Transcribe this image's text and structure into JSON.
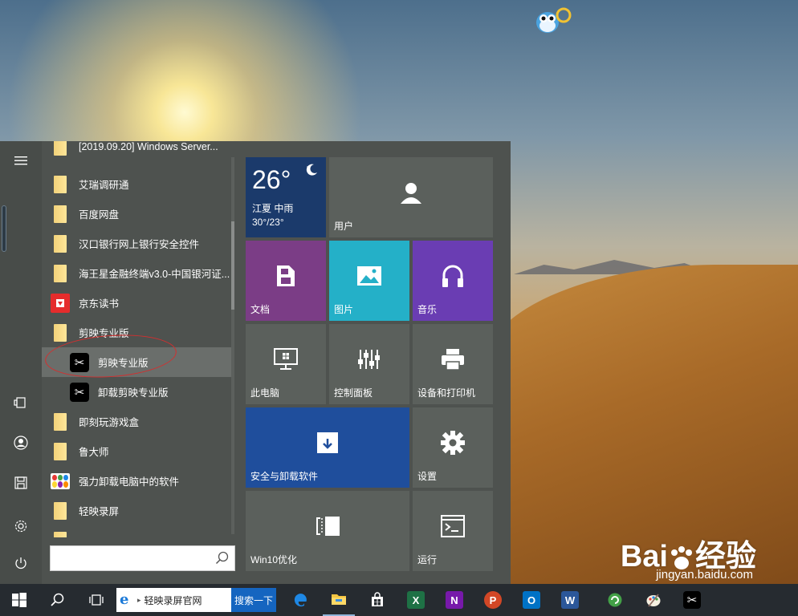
{
  "colors": {
    "start_bg": "#4e524f",
    "tile_weather": "#1b3a6b",
    "tile_gray": "#5b605c",
    "tile_docs": "#7b3d86",
    "tile_pictures": "#24b0c8",
    "tile_music": "#6a3db3",
    "tile_install": "#1f4e9c",
    "annotation": "#d32f2f",
    "taskbar": "#262b30"
  },
  "start_menu": {
    "rail": [
      "hamburger-icon",
      "tablet-icon",
      "user-icon",
      "documents-icon",
      "settings-icon",
      "power-icon"
    ],
    "app_list": [
      {
        "label": "[2019.09.20] Windows Server...",
        "icon": "folder-icon",
        "type": "folder"
      },
      {
        "label": "艾瑞调研通",
        "icon": "folder-icon",
        "type": "folder"
      },
      {
        "label": "百度网盘",
        "icon": "folder-icon",
        "type": "folder"
      },
      {
        "label": "汉口银行网上银行安全控件",
        "icon": "folder-icon",
        "type": "folder"
      },
      {
        "label": "海王星金融终端v3.0-中国银河证...",
        "icon": "folder-icon",
        "type": "folder"
      },
      {
        "label": "京东读书",
        "icon": "jd-read-icon",
        "type": "app"
      },
      {
        "label": "剪映专业版",
        "icon": "folder-icon",
        "type": "folder"
      },
      {
        "label": "剪映专业版",
        "icon": "capcut-icon",
        "type": "sub"
      },
      {
        "label": "卸载剪映专业版",
        "icon": "capcut-icon",
        "type": "sub"
      },
      {
        "label": "即刻玩游戏盒",
        "icon": "folder-icon",
        "type": "folder"
      },
      {
        "label": "鲁大师",
        "icon": "folder-icon",
        "type": "folder"
      },
      {
        "label": "强力卸载电脑中的软件",
        "icon": "uninstaller-icon",
        "type": "app"
      },
      {
        "label": "轻映录屏",
        "icon": "folder-icon",
        "type": "folder"
      }
    ],
    "search_placeholder": "",
    "tiles": {
      "weather": {
        "temp": "26°",
        "city": "江夏  中雨",
        "range": "30°/23°"
      },
      "user": "用户",
      "documents": "文档",
      "pictures": "图片",
      "music": "音乐",
      "this_pc": "此电脑",
      "control_panel": "控制面板",
      "devices_printers": "设备和打印机",
      "install_uninstall": "安全与卸载软件",
      "settings": "设置",
      "win10_optimize": "Win10优化",
      "run": "运行"
    }
  },
  "taskbar": {
    "address_text": "轻映录屏官网",
    "go_label": "搜索一下",
    "excel": "X",
    "onenote": "N",
    "powerpoint": "P",
    "outlook": "O",
    "word": "W"
  },
  "watermark": {
    "brand": "Bai",
    "brand2": "经验",
    "url": "jingyan.baidu.com"
  }
}
